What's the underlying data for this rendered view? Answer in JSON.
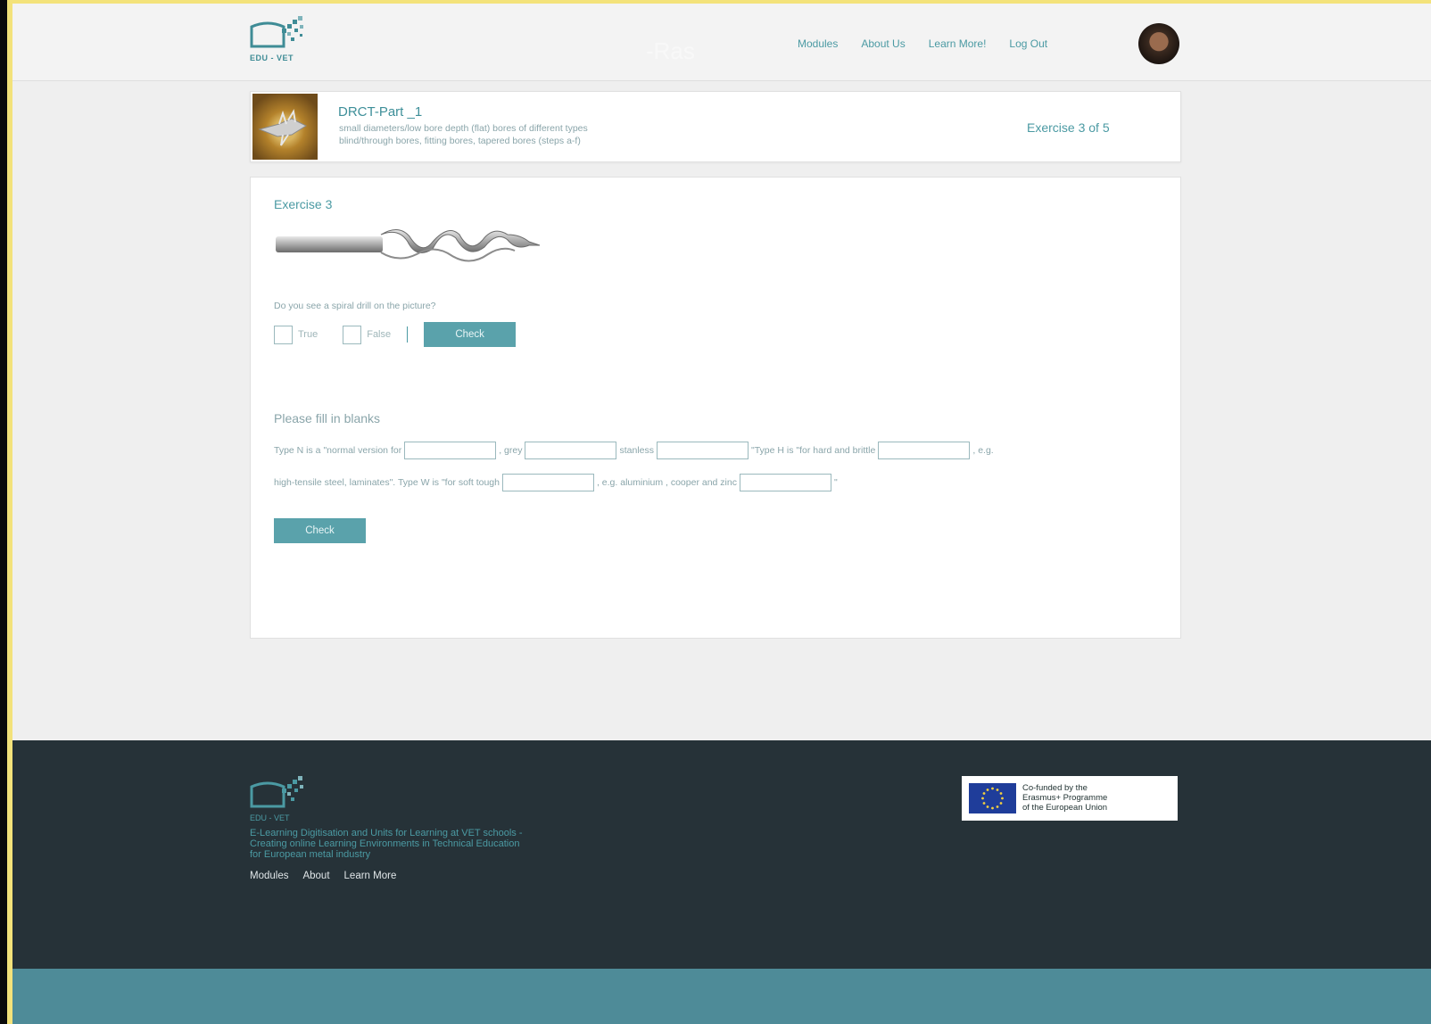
{
  "header": {
    "logo_text": "EDU - VET",
    "ghost_text": "-Ras",
    "nav": [
      "Modules",
      "About Us",
      "Learn More!",
      "Log Out"
    ]
  },
  "module": {
    "title": "DRCT-Part _1",
    "description": "small diameters/low bore depth (flat) bores of different types\nblind/through bores, fitting bores, tapered bores (steps a-f)",
    "progress": "Exercise 3 of 5"
  },
  "exercise": {
    "title": "Exercise 3",
    "question": "Do you see a spiral drill on the picture?",
    "option_true": "True",
    "option_false": "False",
    "check_label": "Check",
    "fill_title": "Please fill in blanks",
    "line1": {
      "t1": "Type N is a \"normal version for",
      "t2": ", grey",
      "t3": "stanless",
      "t4": "\"Type H is \"for hard and brittle",
      "t5": ", e.g."
    },
    "line2": {
      "t1": "high-tensile steel, laminates\". Type W is \"for soft tough",
      "t2": ", e.g. aluminium , cooper and zinc",
      "t3": "\""
    },
    "check2_label": "Check"
  },
  "footer": {
    "logo_text": "EDU - VET",
    "tagline": "E-Learning Digitisation and Units for Learning at VET schools -\nCreating online Learning Environments in Technical Education\nfor European metal industry",
    "links": [
      "Modules",
      "About",
      "Learn More"
    ],
    "eu_text": "Co-funded by the\nErasmus+ Programme\nof the European Union"
  },
  "colors": {
    "accent": "#4b9aa3",
    "button": "#5aa2ab",
    "footer_bg": "#263238",
    "bottom_bar": "#4e8b98"
  },
  "icons": [
    "edu-vet-logo",
    "user-avatar",
    "module-thumbnail",
    "drill-image",
    "eu-flag"
  ]
}
